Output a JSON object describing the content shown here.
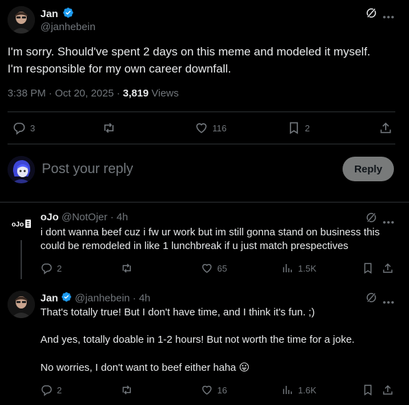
{
  "main_tweet": {
    "author_name": "Jan",
    "author_handle": "@janhebein",
    "text_line1": "I'm sorry. Should've spent 2 days on this meme and modeled it myself.",
    "text_line2": "I'm responsible for my own career downfall.",
    "time": "3:38 PM · Oct 20, 2025 · ",
    "views_count": "3,819",
    "views_label": " Views",
    "replies": "3",
    "likes": "116",
    "bookmarks": "2"
  },
  "composer": {
    "placeholder": "Post your reply",
    "reply_button": "Reply"
  },
  "replies": [
    {
      "author_name": "oJo",
      "author_handle": "@NotOjer",
      "time": "· 4h",
      "avatar_text": "oJo",
      "text_line1": "i dont wanna beef cuz i fw ur work but im still gonna stand on business this",
      "text_line2": "could be remodeled in like 1 lunchbreak if u just match prespectives",
      "replies": "2",
      "likes": "65",
      "views": "1.5K"
    },
    {
      "author_name": "Jan",
      "author_handle": "@janhebein",
      "time": "· 4h",
      "text_p1": "That's totally true! But I don't have time, and I think it's fun. ;)",
      "text_p2": "And yes, totally doable in 1-2 hours! But not worth the time for a joke.",
      "text_p3": "No worries, I don't want to beef either haha",
      "emoji": "😛",
      "replies": "2",
      "likes": "16",
      "views": "1.6K"
    }
  ],
  "colors": {
    "background": "#000000",
    "text": "#e7e9ea",
    "muted": "#71767b",
    "verified": "#1d9bf0",
    "divider": "#2f3336",
    "reply_button_bg": "#787a7a"
  }
}
